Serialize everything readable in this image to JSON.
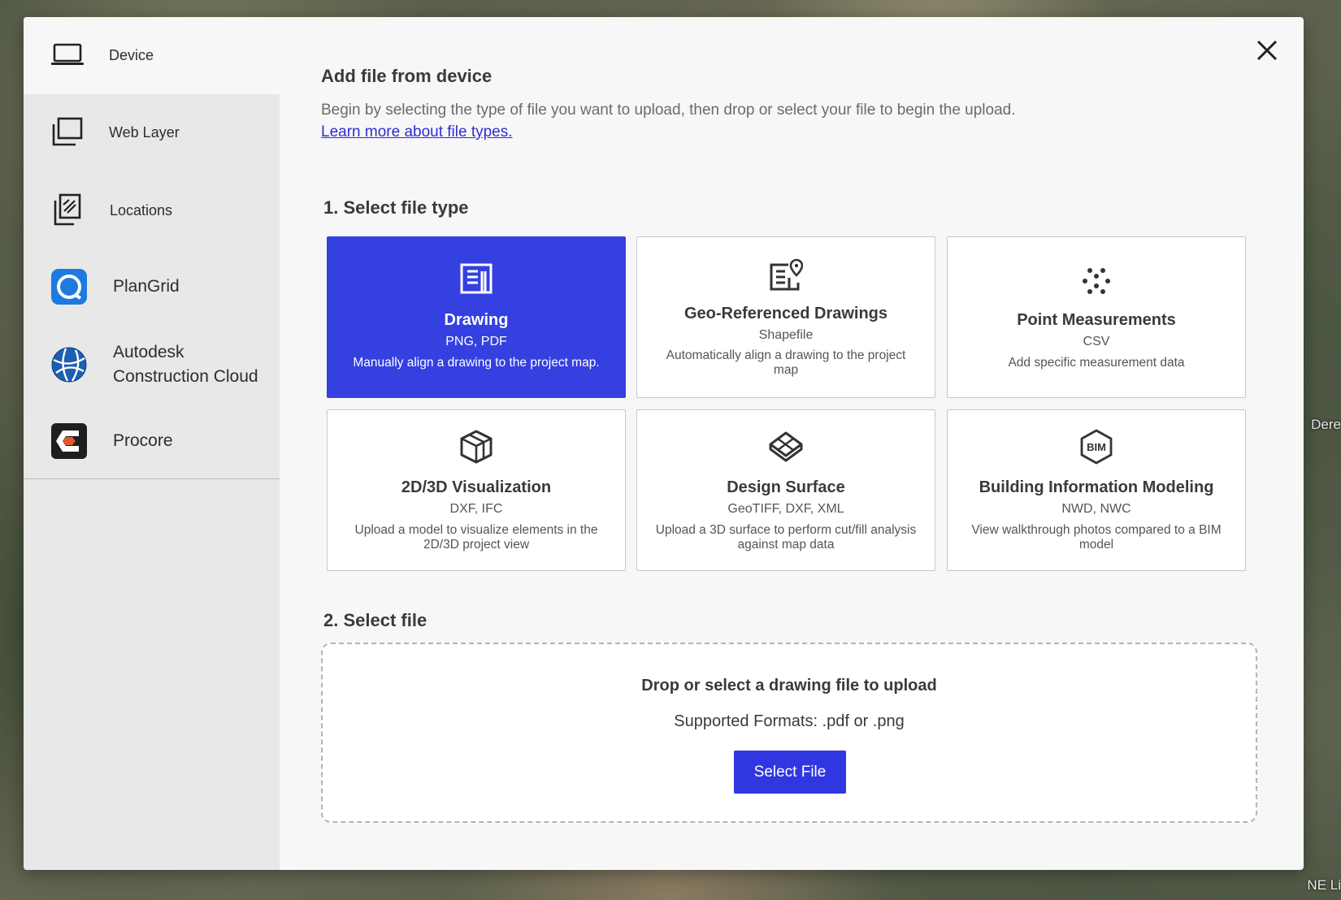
{
  "background": {
    "map_label_right": "Dere",
    "map_label_bottom": "NE Li"
  },
  "sidebar": {
    "items": [
      {
        "label": "Device",
        "icon": "laptop-icon"
      },
      {
        "label": "Web Layer",
        "icon": "web-layer-icon"
      },
      {
        "label": "Locations",
        "icon": "locations-icon"
      },
      {
        "label": "PlanGrid",
        "icon": "plangrid-icon"
      },
      {
        "label": "Autodesk Construction Cloud",
        "icon": "autodesk-construction-cloud-icon"
      },
      {
        "label": "Procore",
        "icon": "procore-icon"
      }
    ],
    "selected": "Device"
  },
  "header": {
    "title": "Add file from device",
    "description": "Begin by selecting the type of file you want to upload, then drop or select your file to begin the upload.",
    "learn_more_link": "Learn more about file types."
  },
  "step1": {
    "title": "1. Select file type",
    "cards": [
      {
        "title": "Drawing",
        "formats": "PNG, PDF",
        "description": "Manually align a drawing to the project map.",
        "icon": "drawing-icon",
        "selected": true
      },
      {
        "title": "Geo-Referenced Drawings",
        "formats": "Shapefile",
        "description": "Automatically align a drawing to the project map",
        "icon": "geo-referenced-drawing-icon",
        "selected": false
      },
      {
        "title": "Point Measurements",
        "formats": "CSV",
        "description": "Add specific measurement data",
        "icon": "point-measurements-icon",
        "selected": false
      },
      {
        "title": "2D/3D Visualization",
        "formats": "DXF, IFC",
        "description": "Upload a model to visualize elements in the 2D/3D project view",
        "icon": "cube-icon",
        "selected": false
      },
      {
        "title": "Design Surface",
        "formats": "GeoTIFF, DXF, XML",
        "description": "Upload a 3D surface to perform cut/fill analysis against map data",
        "icon": "design-surface-icon",
        "selected": false
      },
      {
        "title": "Building Information Modeling",
        "formats": "NWD, NWC",
        "description": "View walkthrough photos compared to a BIM model",
        "icon": "bim-icon",
        "icon_text": "BIM",
        "selected": false
      }
    ]
  },
  "step2": {
    "title": "2. Select file",
    "dropzone_title": "Drop or select a drawing file to upload",
    "supported_formats": "Supported Formats: .pdf or .png",
    "button_label": "Select File"
  },
  "colors": {
    "accent": "#3540e0",
    "link": "#2f2bd6",
    "sidebar_bg": "#e8e8e8",
    "modal_bg": "#f7f7f7"
  }
}
